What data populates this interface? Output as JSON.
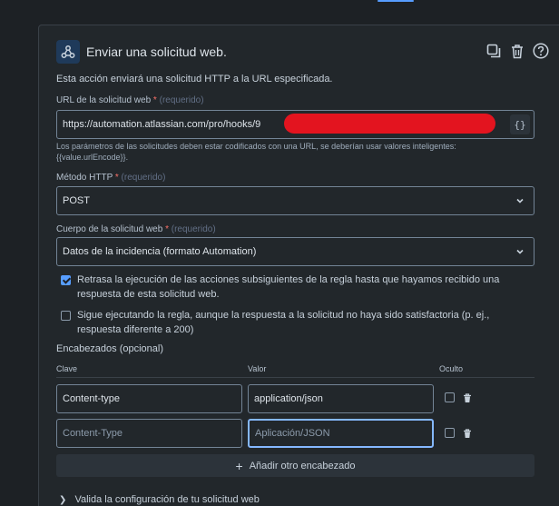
{
  "colors": {
    "accent": "#579dff",
    "redaction": "#e3141f",
    "required": "#f87168"
  },
  "header": {
    "title": "Enviar una solicitud web.",
    "icons": [
      "webhook-icon",
      "duplicate-icon",
      "trash-icon",
      "help-icon"
    ]
  },
  "description": "Esta acción enviará una solicitud HTTP a la URL especificada.",
  "url": {
    "label": "URL de la solicitud web",
    "required_star": "*",
    "required_text": "(requerido)",
    "value": "https://automation.atlassian.com/pro/hooks/9",
    "smart_button": "{}",
    "helper": "Los parámetros de las solicitudes deben estar codificados con una URL, se deberían usar valores inteligentes: {{value.urlEncode}}."
  },
  "method": {
    "label": "Método HTTP",
    "required_star": "*",
    "required_text": "(requerido)",
    "value": "POST"
  },
  "body": {
    "label": "Cuerpo de la solicitud web",
    "required_star": "*",
    "required_text": "(requerido)",
    "value": "Datos de la incidencia (formato Automation)"
  },
  "options": [
    {
      "checked": true,
      "text": "Retrasa la ejecución de las acciones subsiguientes de la regla hasta que hayamos recibido una respuesta de esta solicitud web."
    },
    {
      "checked": false,
      "text": "Sigue ejecutando la regla, aunque la respuesta a la solicitud no haya sido satisfactoria (p. ej., respuesta diferente a 200)"
    }
  ],
  "headers_section": {
    "title": "Encabezados (opcional)",
    "columns": [
      "Clave",
      "Valor",
      "Oculto"
    ],
    "rows": [
      {
        "key": "Content-type",
        "value": "application/json",
        "hidden": false
      },
      {
        "key_placeholder": "Content-Type",
        "value_placeholder": "Aplicación/JSON",
        "hidden": false
      }
    ],
    "add_label": "Añadir otro encabezado"
  },
  "validate_label": "Valida la configuración de tu solicitud web"
}
